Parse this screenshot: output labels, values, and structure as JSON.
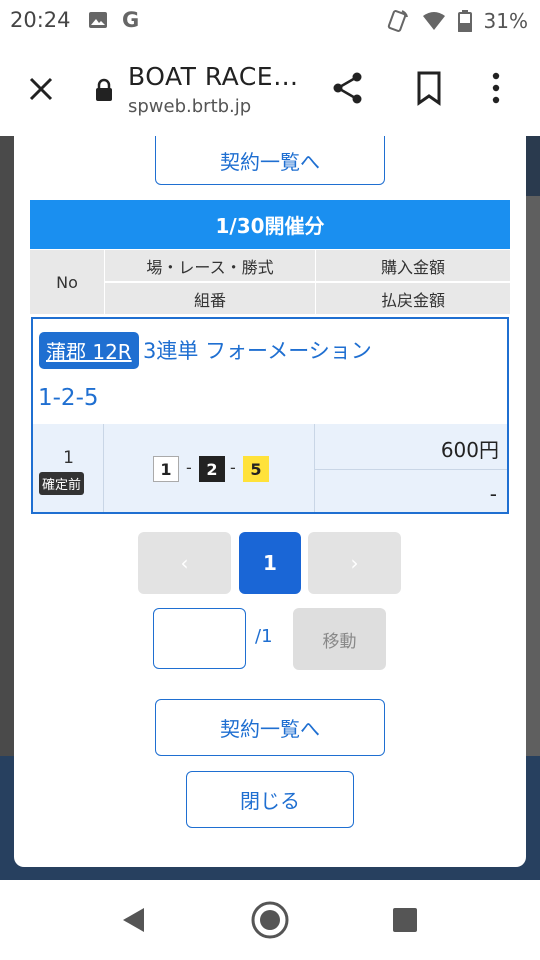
{
  "status_bar": {
    "time": "20:24",
    "battery": "31%",
    "icons": [
      "image-icon",
      "google-g-icon",
      "hotspot-icon",
      "wifi-icon",
      "battery-icon"
    ]
  },
  "browser": {
    "title": "BOAT RACE…",
    "url": "spweb.brtb.jp"
  },
  "modal": {
    "contract_list_top_label": "契約一覧へ",
    "date_header": "1/30開催分",
    "columns": {
      "no": "No",
      "venue_race_type": "場・レース・勝式",
      "purchase_amount": "購入金額",
      "combination": "組番",
      "payout_amount": "払戻金額"
    },
    "record": {
      "venue_race": "蒲郡 12R",
      "bet_type": "3連単 フォーメーション",
      "combination_text": "1-2-5",
      "no": "1",
      "status": "確定前",
      "boats": [
        "1",
        "2",
        "5"
      ],
      "separator": "-",
      "purchase": "600円",
      "payout": "-"
    },
    "pagination": {
      "prev": "‹",
      "current": "1",
      "next": "›"
    },
    "page_jump": {
      "input_value": "",
      "total": "/1",
      "move_label": "移動"
    },
    "contract_list_bottom_label": "契約一覧へ",
    "close_label": "閉じる"
  },
  "colors": {
    "accent": "#1f6fd1",
    "header_bar": "#1a8ff0",
    "boat5": "#ffe23a"
  }
}
